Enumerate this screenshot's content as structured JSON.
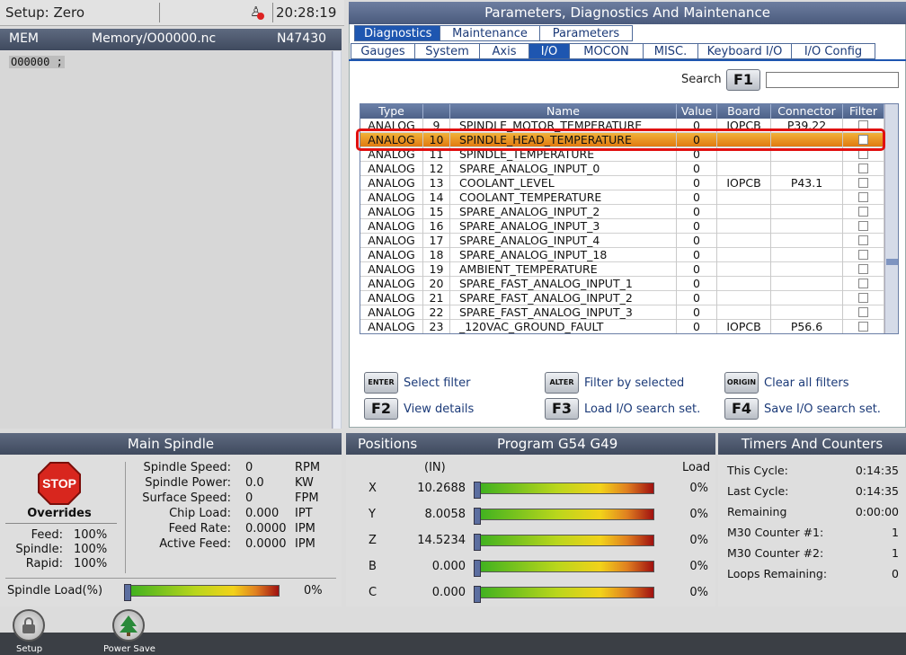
{
  "status_bar": {
    "setup": "Setup: Zero",
    "time": "20:28:19"
  },
  "program": {
    "mode": "MEM",
    "file": "Memory/O00000.nc",
    "line": "N47430",
    "code_line": "O00000 ;"
  },
  "panel": {
    "title": "Parameters, Diagnostics And Maintenance",
    "tabs_top": [
      "Diagnostics",
      "Maintenance",
      "Parameters"
    ],
    "tabs_sub": [
      "Gauges",
      "System",
      "Axis",
      "I/O",
      "MOCON",
      "MISC.",
      "Keyboard I/O",
      "I/O Config"
    ],
    "search_label": "Search",
    "search_key": "F1",
    "columns": [
      "Type",
      "",
      "Name",
      "Value",
      "Board",
      "Connector",
      "Filter"
    ],
    "rows": [
      {
        "type": "ANALOG",
        "num": "9",
        "name": "SPINDLE_MOTOR_TEMPERATURE",
        "value": "0",
        "board": "IOPCB",
        "conn": "P39.22"
      },
      {
        "type": "ANALOG",
        "num": "10",
        "name": "SPINDLE_HEAD_TEMPERATURE",
        "value": "0",
        "board": "",
        "conn": ""
      },
      {
        "type": "ANALOG",
        "num": "11",
        "name": "SPINDLE_TEMPERATURE",
        "value": "0",
        "board": "",
        "conn": ""
      },
      {
        "type": "ANALOG",
        "num": "12",
        "name": "SPARE_ANALOG_INPUT_0",
        "value": "0",
        "board": "",
        "conn": ""
      },
      {
        "type": "ANALOG",
        "num": "13",
        "name": "COOLANT_LEVEL",
        "value": "0",
        "board": "IOPCB",
        "conn": "P43.1"
      },
      {
        "type": "ANALOG",
        "num": "14",
        "name": "COOLANT_TEMPERATURE",
        "value": "0",
        "board": "",
        "conn": ""
      },
      {
        "type": "ANALOG",
        "num": "15",
        "name": "SPARE_ANALOG_INPUT_2",
        "value": "0",
        "board": "",
        "conn": ""
      },
      {
        "type": "ANALOG",
        "num": "16",
        "name": "SPARE_ANALOG_INPUT_3",
        "value": "0",
        "board": "",
        "conn": ""
      },
      {
        "type": "ANALOG",
        "num": "17",
        "name": "SPARE_ANALOG_INPUT_4",
        "value": "0",
        "board": "",
        "conn": ""
      },
      {
        "type": "ANALOG",
        "num": "18",
        "name": "SPARE_ANALOG_INPUT_18",
        "value": "0",
        "board": "",
        "conn": ""
      },
      {
        "type": "ANALOG",
        "num": "19",
        "name": "AMBIENT_TEMPERATURE",
        "value": "0",
        "board": "",
        "conn": ""
      },
      {
        "type": "ANALOG",
        "num": "20",
        "name": "SPARE_FAST_ANALOG_INPUT_1",
        "value": "0",
        "board": "",
        "conn": ""
      },
      {
        "type": "ANALOG",
        "num": "21",
        "name": "SPARE_FAST_ANALOG_INPUT_2",
        "value": "0",
        "board": "",
        "conn": ""
      },
      {
        "type": "ANALOG",
        "num": "22",
        "name": "SPARE_FAST_ANALOG_INPUT_3",
        "value": "0",
        "board": "",
        "conn": ""
      },
      {
        "type": "ANALOG",
        "num": "23",
        "name": "_120VAC_GROUND_FAULT",
        "value": "0",
        "board": "IOPCB",
        "conn": "P56.6"
      }
    ],
    "actions": [
      {
        "key": "ENTER",
        "label": "Select filter"
      },
      {
        "key": "ALTER",
        "label": "Filter by selected"
      },
      {
        "key": "ORIGIN",
        "label": "Clear all filters"
      },
      {
        "key": "F2",
        "label": "View details"
      },
      {
        "key": "F3",
        "label": "Load I/O search set."
      },
      {
        "key": "F4",
        "label": "Save I/O search set."
      }
    ]
  },
  "spindle": {
    "title": "Main Spindle",
    "stop": "STOP",
    "overrides_title": "Overrides",
    "overrides": [
      {
        "label": "Feed:",
        "value": "100%"
      },
      {
        "label": "Spindle:",
        "value": "100%"
      },
      {
        "label": "Rapid:",
        "value": "100%"
      }
    ],
    "stats": [
      {
        "label": "Spindle Speed:",
        "value": "0",
        "unit": "RPM"
      },
      {
        "label": "Spindle Power:",
        "value": "0.0",
        "unit": "KW"
      },
      {
        "label": "Surface Speed:",
        "value": "0",
        "unit": "FPM"
      },
      {
        "label": "Chip Load:",
        "value": "0.000",
        "unit": "IPT"
      },
      {
        "label": "Feed Rate:",
        "value": "0.0000",
        "unit": "IPM"
      },
      {
        "label": "Active Feed:",
        "value": "0.0000",
        "unit": "IPM"
      }
    ],
    "load_label": "Spindle Load(%)",
    "load_value": "0%"
  },
  "positions": {
    "title": "Positions",
    "program": "Program G54 G49",
    "units": "(IN)",
    "load_label": "Load",
    "axes": [
      {
        "axis": "X",
        "value": "10.2688",
        "load": "0%"
      },
      {
        "axis": "Y",
        "value": "8.0058",
        "load": "0%"
      },
      {
        "axis": "Z",
        "value": "14.5234",
        "load": "0%"
      },
      {
        "axis": "B",
        "value": "0.000",
        "load": "0%"
      },
      {
        "axis": "C",
        "value": "0.000",
        "load": "0%"
      }
    ]
  },
  "timers": {
    "title": "Timers And Counters",
    "items": [
      {
        "label": "This Cycle:",
        "value": "0:14:35"
      },
      {
        "label": "Last Cycle:",
        "value": "0:14:35"
      },
      {
        "label": "Remaining",
        "value": "0:00:00"
      },
      {
        "label": "M30 Counter #1:",
        "value": "1"
      },
      {
        "label": "M30 Counter #2:",
        "value": "1"
      },
      {
        "label": "Loops Remaining:",
        "value": "0"
      }
    ]
  },
  "footer": {
    "setup": "Setup",
    "power_save": "Power Save"
  }
}
